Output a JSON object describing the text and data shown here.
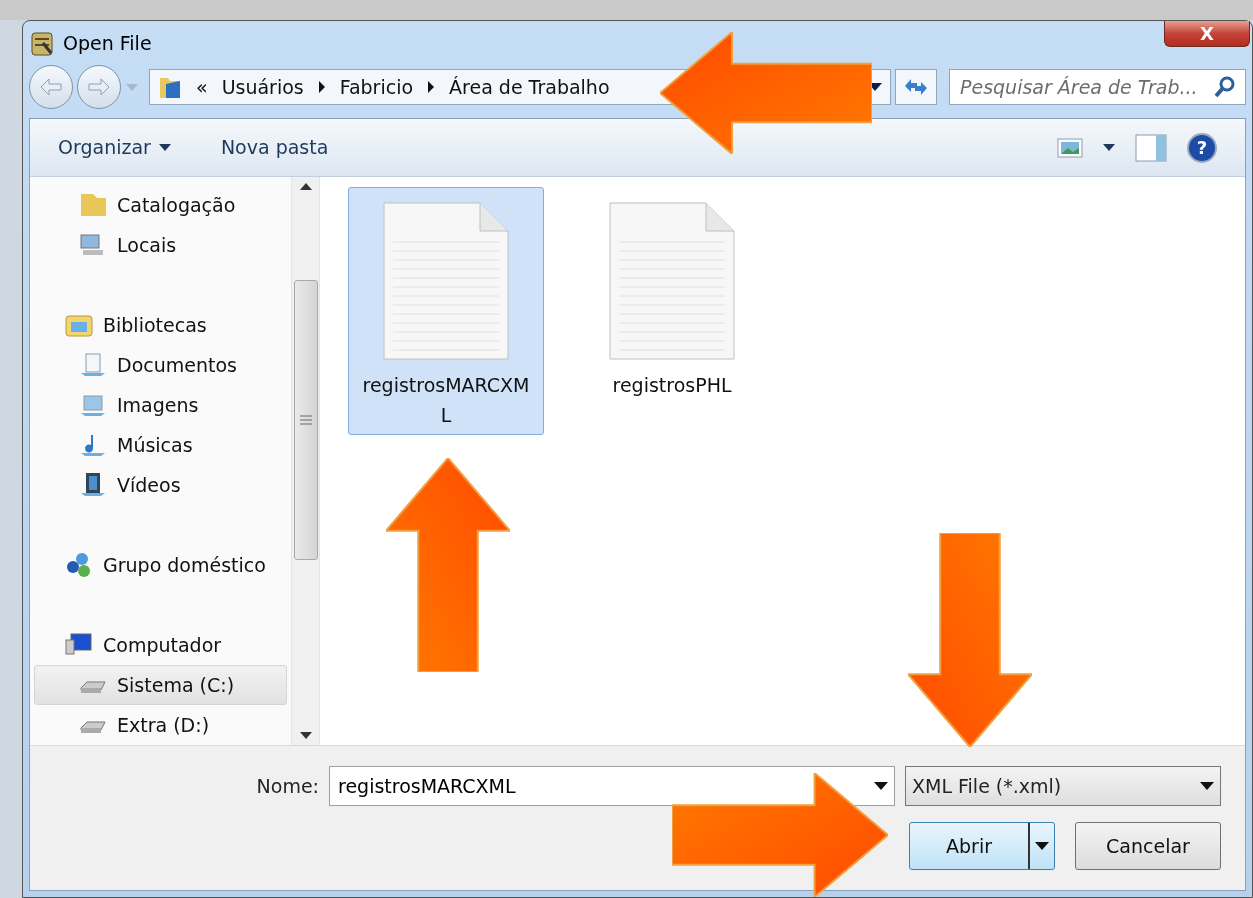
{
  "window": {
    "title": "Open File",
    "close": "X"
  },
  "address": {
    "overflow": "«",
    "crumbs": [
      "Usuários",
      "Fabricio",
      "Área de Trabalho"
    ]
  },
  "search": {
    "placeholder": "Pesquisar Área de Trab..."
  },
  "toolbar": {
    "organize": "Organizar",
    "new_folder": "Nova pasta",
    "help": "?"
  },
  "sidebar": {
    "groups": [
      {
        "children": [
          {
            "label": "Catalogação",
            "selected": false
          },
          {
            "label": "Locais",
            "selected": false
          }
        ]
      },
      {
        "label": "Bibliotecas",
        "selected": false,
        "children": [
          {
            "label": "Documentos",
            "selected": false
          },
          {
            "label": "Imagens",
            "selected": false
          },
          {
            "label": "Músicas",
            "selected": false
          },
          {
            "label": "Vídeos",
            "selected": false
          }
        ]
      },
      {
        "label": "Grupo doméstico",
        "selected": false
      },
      {
        "label": "Computador",
        "selected": false,
        "children": [
          {
            "label": "Sistema (C:)",
            "selected": true
          },
          {
            "label": "Extra (D:)",
            "selected": false
          }
        ]
      }
    ]
  },
  "files": [
    {
      "name": "registrosMARCXML",
      "selected": true
    },
    {
      "name": "registrosPHL",
      "selected": false
    }
  ],
  "filename": {
    "label": "Nome:",
    "value": "registrosMARCXML"
  },
  "filter": {
    "value": "XML File (*.xml)"
  },
  "buttons": {
    "open": "Abrir",
    "cancel": "Cancelar"
  }
}
